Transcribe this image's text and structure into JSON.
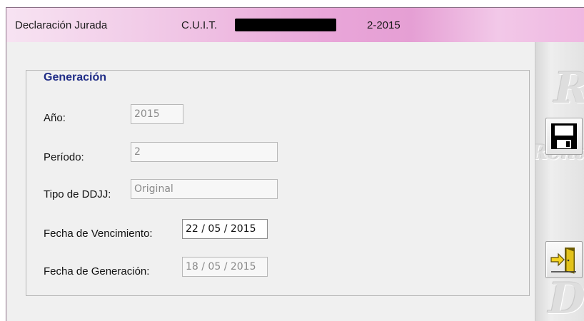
{
  "window": {
    "title": "Declaración Jurada",
    "cuit_label": "C.U.I.T.",
    "period": "2-2015"
  },
  "form": {
    "group_title": "Generación",
    "fields": {
      "anio": {
        "label": "Año:",
        "value": "2015"
      },
      "periodo": {
        "label": "Período:",
        "value": "2"
      },
      "tipo_ddjj": {
        "label": "Tipo de DDJJ:",
        "value": "Original"
      },
      "fecha_vencimiento": {
        "label": "Fecha de Vencimiento:",
        "value": "22 / 05 / 2015"
      },
      "fecha_generacion": {
        "label": "Fecha de Generación:",
        "value": "18 / 05 / 2015"
      }
    }
  },
  "toolbar": {
    "save_icon": "floppy-disk-icon",
    "exit_icon": "exit-door-icon"
  },
  "colors": {
    "title_gradient": "#e9a6d9",
    "group_title": "#1f2c86",
    "background": "#f0f0f0"
  }
}
